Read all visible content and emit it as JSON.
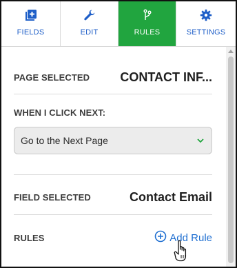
{
  "tabs": [
    {
      "label": "FIELDS",
      "icon": "add-box-icon",
      "active": false
    },
    {
      "label": "EDIT",
      "icon": "wrench-icon",
      "active": false
    },
    {
      "label": "RULES",
      "icon": "branch-icon",
      "active": true
    },
    {
      "label": "SETTINGS",
      "icon": "gear-icon",
      "active": false
    }
  ],
  "colors": {
    "accent": "#21a53f",
    "link": "#1f6fd1",
    "tab_label": "#1f5fc8",
    "chevron": "#21a53f"
  },
  "page_selected": {
    "label": "PAGE SELECTED",
    "value": "CONTACT INF..."
  },
  "when_next": {
    "label": "WHEN I CLICK NEXT:",
    "select_value": "Go to the Next Page"
  },
  "field_selected": {
    "label": "FIELD SELECTED",
    "value": "Contact Email"
  },
  "rules": {
    "label": "RULES",
    "add_label": "Add Rule"
  }
}
